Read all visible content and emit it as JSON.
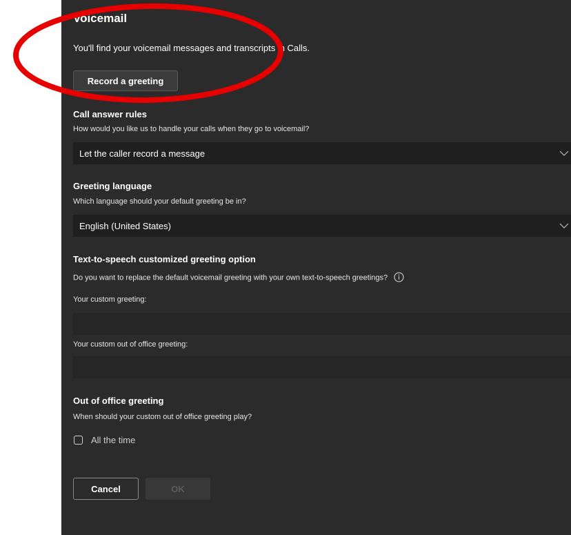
{
  "voicemail": {
    "title": "Voicemail",
    "intro": "You'll find your voicemail messages and transcripts in Calls.",
    "record_button": "Record a greeting"
  },
  "call_answer_rules": {
    "title": "Call answer rules",
    "description": "How would you like us to handle your calls when they go to voicemail?",
    "selected_value": "Let the caller record a message"
  },
  "greeting_language": {
    "title": "Greeting language",
    "description": "Which language should your default greeting be in?",
    "selected_value": "English (United States)"
  },
  "tts": {
    "title": "Text-to-speech customized greeting option",
    "description": "Do you want to replace the default voicemail greeting with your own text-to-speech greetings?",
    "custom_greeting_label": "Your custom greeting:",
    "custom_greeting_value": "",
    "custom_ooo_label": "Your custom out of office greeting:",
    "custom_ooo_value": ""
  },
  "out_of_office": {
    "title": "Out of office greeting",
    "description": "When should your custom out of office greeting play?",
    "checkbox_label": "All the time",
    "checkbox_checked": false
  },
  "footer": {
    "cancel_label": "Cancel",
    "ok_label": "OK"
  },
  "colors": {
    "panel_background": "#2b2b2b",
    "field_background": "#1f1f1f",
    "annotation_stroke": "#e60000"
  },
  "icons": {
    "dropdown": "chevron-down-icon",
    "info": "info-icon"
  }
}
